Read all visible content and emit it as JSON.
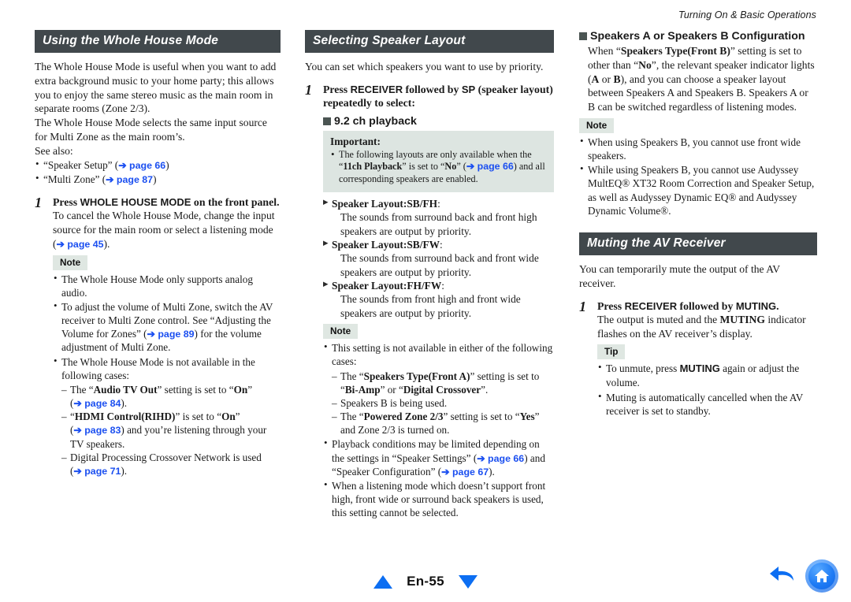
{
  "running_header": "Turning On & Basic Operations",
  "column1": {
    "section_title": "Using the Whole House Mode",
    "intro_p1": "The Whole House Mode is useful when you want to add extra background music to your home party; this allows you to enjoy the same stereo music as the main room in separate rooms (Zone 2/3).",
    "intro_p2": "The Whole House Mode selects the same input source for Multi Zone as the main room’s.",
    "see_also_label": "See also:",
    "see_also": [
      {
        "pre": "“Speaker Setup” (",
        "link": "➔ page 66",
        "post": ")"
      },
      {
        "pre": "“Multi Zone” (",
        "link": "➔ page 87",
        "post": ")"
      }
    ],
    "step": {
      "number": "1",
      "head_pre": "Press ",
      "head_kbd": "WHOLE HOUSE MODE",
      "head_post": " on the front panel.",
      "body_pre": "To cancel the Whole House Mode, change the input source for the main room or select a listening mode (",
      "body_link": "➔ page 45",
      "body_post": ")."
    },
    "note_badge": "Note",
    "notes": {
      "n1": "The Whole House Mode only supports analog audio.",
      "n2_a": "To adjust the volume of Multi Zone, switch the AV receiver to Multi Zone control. See “Adjusting the Volume for Zones” (",
      "n2_link": "➔ page 89",
      "n2_b": ") for the volume adjustment of Multi Zone.",
      "n3": "The Whole House Mode is not available in the following cases:",
      "sub1_a": "The “",
      "sub1_bold": "Audio TV Out",
      "sub1_b": "” setting is set to “",
      "sub1_bold2": "On",
      "sub1_c": "” (",
      "sub1_link": "➔ page 84",
      "sub1_d": ").",
      "sub2_a": "“",
      "sub2_bold": "HDMI Control(RIHD)",
      "sub2_b": "” is set to “",
      "sub2_bold2": "On",
      "sub2_c": "” (",
      "sub2_link": "➔ page 83",
      "sub2_d": ") and you’re listening through your TV speakers.",
      "sub3_a": "Digital Processing Crossover Network is used (",
      "sub3_link": "➔ page 71",
      "sub3_b": ")."
    }
  },
  "column2": {
    "section_title": "Selecting Speaker Layout",
    "intro": "You can set which speakers you want to use by priority.",
    "step": {
      "number": "1",
      "head_pre": "Press ",
      "head_kbd1": "RECEIVER",
      "head_mid": " followed by ",
      "head_kbd2": "SP",
      "head_post": " (speaker layout) repeatedly to select:"
    },
    "playback_heading": "9.2 ch playback",
    "important": {
      "title": "Important:",
      "text_a": "The following layouts are only available when the “",
      "bold1": "11ch Playback",
      "text_b": "” is set to “",
      "bold2": "No",
      "text_c": "” (",
      "link": "➔ page 66",
      "text_d": ") and all corresponding speakers are enabled."
    },
    "layouts": [
      {
        "title": "Speaker Layout:SB/FH",
        "colon": ":",
        "desc": "The sounds from surround back and front high speakers are output by priority."
      },
      {
        "title": "Speaker Layout:SB/FW",
        "colon": ":",
        "desc": "The sounds from surround back and front wide speakers are output by priority."
      },
      {
        "title": "Speaker Layout:FH/FW",
        "colon": ":",
        "desc": "The sounds from front high and front wide speakers are output by priority."
      }
    ],
    "note_badge": "Note",
    "notes": {
      "n1": "This setting is not available in either of the following cases:",
      "s1_a": "The “",
      "s1_b1": "Speakers Type(Front A)",
      "s1_b": "” setting is set to “",
      "s1_b2": "Bi-Amp",
      "s1_c": "” or “",
      "s1_b3": "Digital Crossover",
      "s1_d": "”.",
      "s2": "Speakers B is being used.",
      "s3_a": "The “",
      "s3_b1": "Powered Zone 2/3",
      "s3_b": "” setting is set to “",
      "s3_b2": "Yes",
      "s3_c": "” and Zone 2/3 is turned on.",
      "n2_a": "Playback conditions may be limited depending on the settings in “Speaker Settings” (",
      "n2_link1": "➔ page 66",
      "n2_b": ") and “Speaker Configuration” (",
      "n2_link2": "➔ page 67",
      "n2_c": ").",
      "n3": "When a listening mode which doesn’t support front high, front wide or surround back speakers is used, this setting cannot be selected."
    }
  },
  "column3": {
    "speakers_heading": "Speakers A or Speakers B Configuration",
    "speakers_body_a": "When “",
    "speakers_body_b1": "Speakers Type(Front B)",
    "speakers_body_b": "” setting is set to other than “",
    "speakers_body_b2": "No",
    "speakers_body_c": "”, the relevant speaker indicator lights (",
    "speakers_body_b3": "A",
    "speakers_body_d": " or ",
    "speakers_body_b4": "B",
    "speakers_body_e": "), and you can choose a speaker layout between Speakers A and Speakers B. Speakers A or B can be switched regardless of listening modes.",
    "note_badge": "Note",
    "notes": {
      "n1": "When using Speakers B, you cannot use front wide speakers.",
      "n2": "While using Speakers B, you cannot use Audyssey MultEQ® XT32 Room Correction and Speaker Setup, as well as Audyssey Dynamic EQ® and Audyssey Dynamic Volume®."
    },
    "muting_title": "Muting the AV Receiver",
    "muting_intro": "You can temporarily mute the output of the AV receiver.",
    "step": {
      "number": "1",
      "head_pre": "Press ",
      "head_kbd1": "RECEIVER",
      "head_mid": " followed by ",
      "head_kbd2": "MUTING",
      "head_post": ".",
      "body_a": "The output is muted and the ",
      "body_b": "MUTING",
      "body_c": " indicator flashes on the AV receiver’s display."
    },
    "tip_badge": "Tip",
    "tips": {
      "t1_a": "To unmute, press ",
      "t1_b": "MUTING",
      "t1_c": " again or adjust the volume.",
      "t2": "Muting is automatically cancelled when the AV receiver is set to standby."
    }
  },
  "footer": {
    "page_label": "En-55",
    "prev_icon": "triangle-up-icon",
    "next_icon": "triangle-down-icon",
    "back_icon": "back-arrow-icon",
    "home_icon": "home-icon"
  },
  "colors": {
    "bar_bg": "#41484c",
    "badge_bg": "#dfe7e2",
    "important_bg": "#dde5e1",
    "link_blue": "#1b4ff0",
    "nav_blue": "#0c6ef2",
    "square_bullet": "#4b5553"
  }
}
